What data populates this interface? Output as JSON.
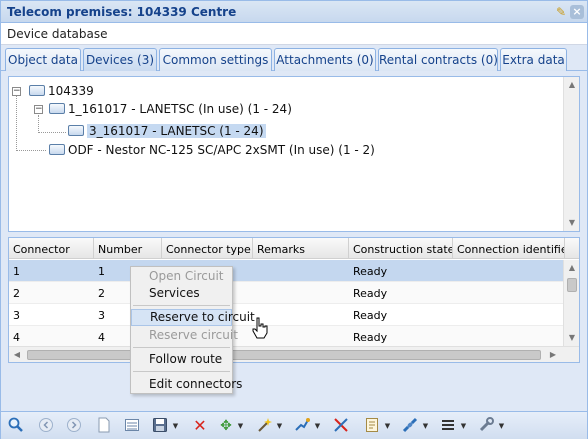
{
  "window": {
    "title": "Telecom premises: 104339 Centre",
    "subtitle": "Device database",
    "pin_glyph": "✎",
    "close_glyph": "×"
  },
  "tabs": [
    {
      "label": "Object data",
      "active": false
    },
    {
      "label": "Devices (3)",
      "active": true
    },
    {
      "label": "Common settings",
      "active": false
    },
    {
      "label": "Attachments (0)",
      "active": false
    },
    {
      "label": "Rental contracts (0)",
      "active": false
    },
    {
      "label": "Extra data",
      "active": false
    }
  ],
  "tree": {
    "toggle_collapse": "−",
    "nodes": [
      {
        "label": "104339",
        "selected": false
      },
      {
        "label": "1_161017 - LANETSC (In use) (1 - 24)",
        "selected": false
      },
      {
        "label": "3_161017 - LANETSC (1 - 24)",
        "selected": true
      },
      {
        "label": "ODF - Nestor NC-125 SC/APC 2xSMT (In use) (1 - 2)",
        "selected": false
      }
    ]
  },
  "grid": {
    "columns": [
      "Connector",
      "Number",
      "Connector type",
      "Remarks",
      "Construction state",
      "Connection identifier"
    ],
    "rows": [
      {
        "connector": "1",
        "number": "1",
        "construction_state": "Ready",
        "selected": true
      },
      {
        "connector": "2",
        "number": "2",
        "construction_state": "Ready",
        "selected": false
      },
      {
        "connector": "3",
        "number": "3",
        "construction_state": "Ready",
        "selected": false
      },
      {
        "connector": "4",
        "number": "4",
        "construction_state": "Ready",
        "selected": false
      }
    ]
  },
  "context_menu": {
    "items": [
      {
        "label": "Open Circuit",
        "disabled": true
      },
      {
        "label": "Services",
        "disabled": false
      },
      {
        "label": "Reserve to circuit",
        "disabled": false,
        "hover": true
      },
      {
        "label": "Reserve circuit",
        "disabled": true
      },
      {
        "label": "Follow route",
        "disabled": false
      },
      {
        "label": "Edit connectors",
        "disabled": false
      }
    ]
  },
  "toolbar": {
    "icons": [
      "search-icon",
      "back-icon",
      "forward-icon",
      "new-document-icon",
      "form-icon",
      "save-icon",
      "delete-icon",
      "move-icon",
      "wand-icon",
      "route-icon",
      "scissors-icon",
      "report-icon",
      "connect-icon",
      "list-icon",
      "tools-icon"
    ]
  },
  "colors": {
    "accent": "#15428b",
    "panel_bg": "#dfe8f6",
    "border": "#99bbe8",
    "selection": "#c4d7ef"
  }
}
